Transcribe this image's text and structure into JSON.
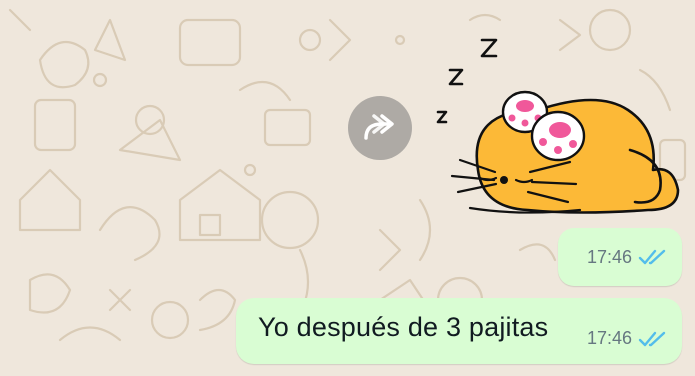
{
  "colors": {
    "wallpaper": "#efe7dc",
    "doodle": "#d9cbb6",
    "bubble_out": "#d9fdd3",
    "read_tick": "#53bdeb",
    "time_text": "#667781",
    "cat_orange": "#fcb937"
  },
  "forward_button": {
    "icon": "forward-arrow-icon"
  },
  "sticker": {
    "description_icon": "sleeping-cat-sticker",
    "zz_letters": [
      "Z",
      "Z",
      "Z"
    ]
  },
  "messages": [
    {
      "type": "sticker",
      "time": "17:46",
      "status": "read"
    },
    {
      "type": "text",
      "text": "Yo después de 3 pajitas",
      "time": "17:46",
      "status": "read"
    }
  ]
}
